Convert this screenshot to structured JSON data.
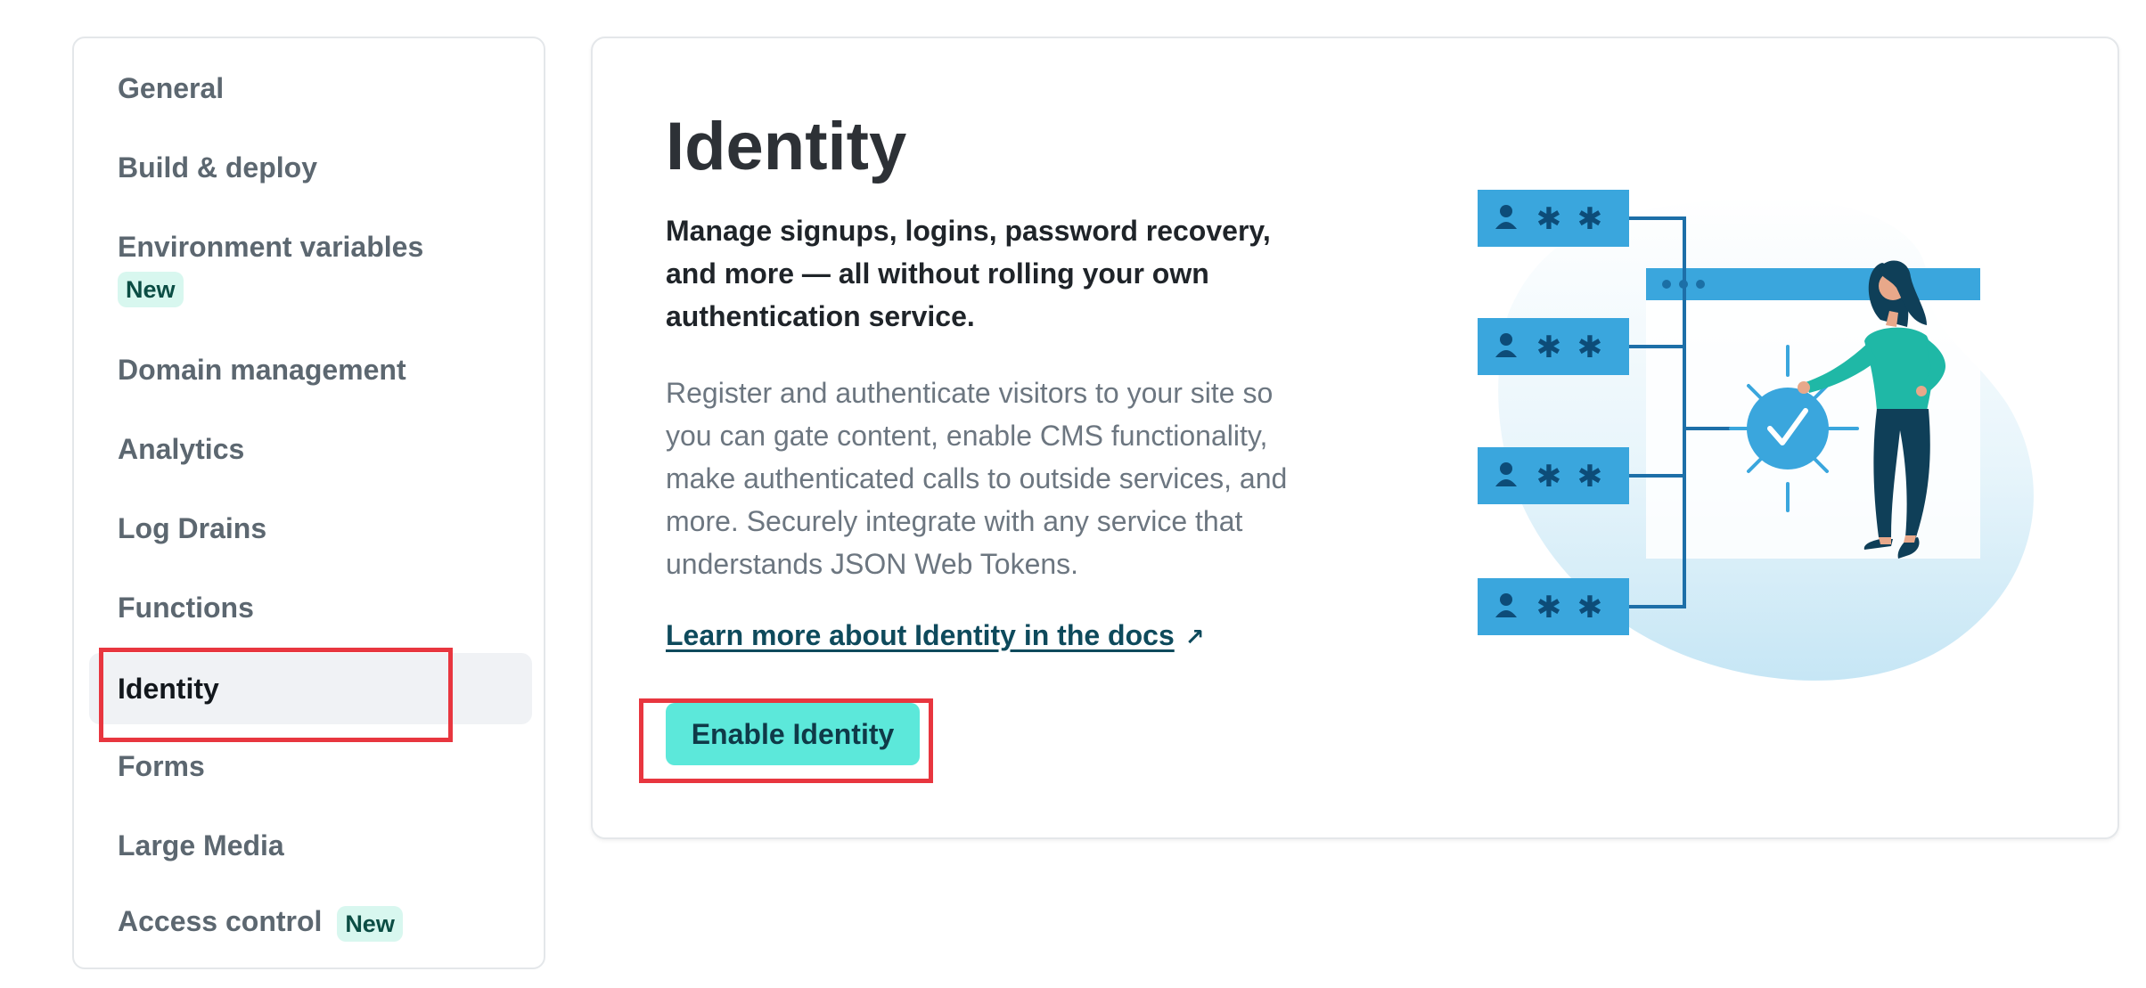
{
  "sidebar": {
    "items": [
      {
        "label": "General"
      },
      {
        "label": "Build & deploy"
      },
      {
        "label": "Environment variables",
        "badge": "New"
      },
      {
        "label": "Domain management"
      },
      {
        "label": "Analytics"
      },
      {
        "label": "Log Drains"
      },
      {
        "label": "Functions"
      },
      {
        "label": "Identity",
        "active": true
      },
      {
        "label": "Forms"
      },
      {
        "label": "Large Media"
      },
      {
        "label": "Access control",
        "badge": "New"
      }
    ]
  },
  "main": {
    "title": "Identity",
    "lead": "Manage signups, logins, password recovery, and more — all without rolling your own authentication service.",
    "description": "Register and authenticate visitors to your site so you can gate content, enable CMS functionality, make authenticated calls to outside services, and more. Securely integrate with any service that understands JSON Web Tokens.",
    "docs_link": "Learn more about Identity in the docs",
    "docs_link_icon": "↗",
    "enable_button": "Enable Identity"
  },
  "colors": {
    "accent_button": "#5ce8da",
    "link": "#0e4a5c",
    "badge_bg": "#d8f7ef",
    "highlight": "#e8363f",
    "illustration_blue": "#3aa6dd"
  }
}
